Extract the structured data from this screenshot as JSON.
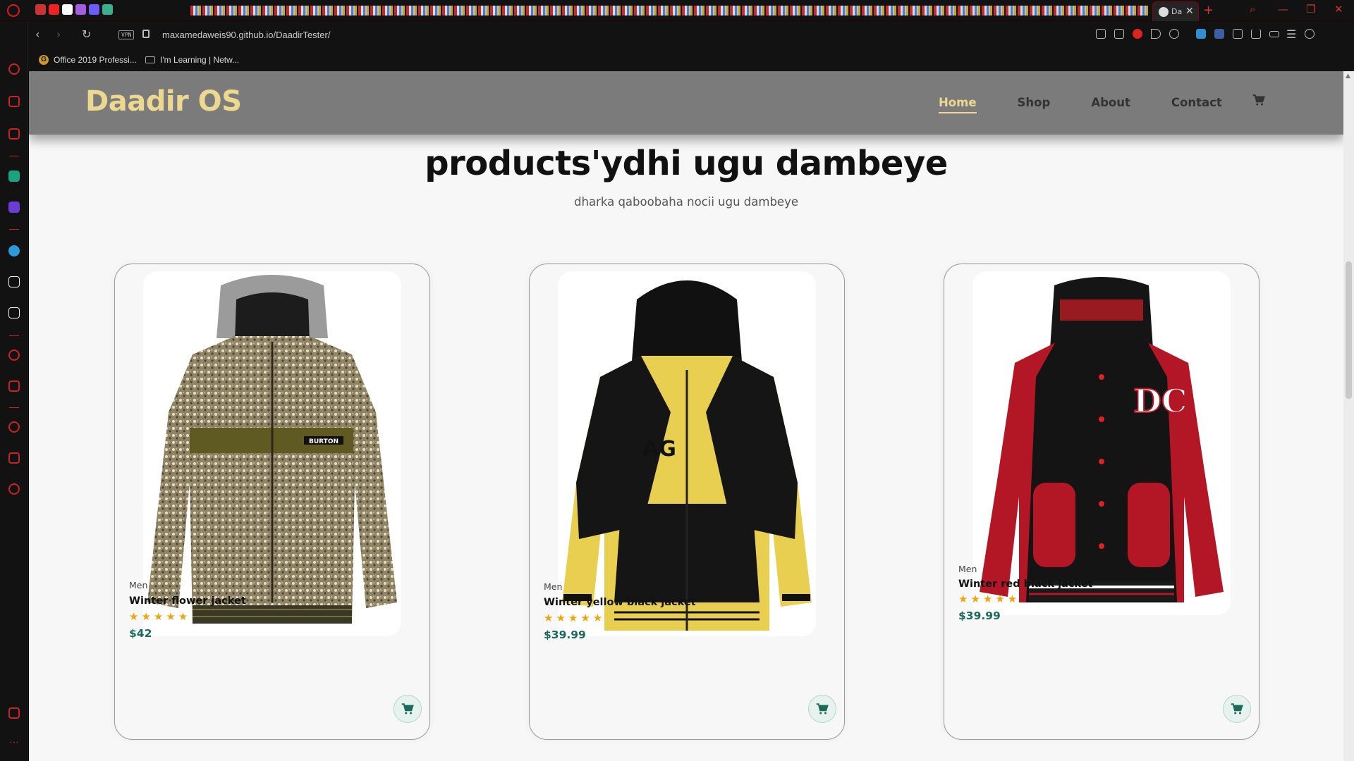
{
  "browser": {
    "active_tab_title": "Da",
    "url_host": "maxamedaweis90.github.io",
    "url_path": "/DaadirTester/",
    "vpn_label": "VPN",
    "bookmarks": [
      {
        "label": "Office 2019 Professi...",
        "icon": "g-icon"
      },
      {
        "label": "I'm Learning | Netw...",
        "icon": "bookmark-page-icon"
      }
    ]
  },
  "site": {
    "logo": "Daadir OS",
    "nav": [
      {
        "label": "Home",
        "active": true
      },
      {
        "label": "Shop",
        "active": false
      },
      {
        "label": "About",
        "active": false
      },
      {
        "label": "Contact",
        "active": false
      }
    ],
    "accent_color": "#ecd98f",
    "header_color": "#7b7b7b"
  },
  "section": {
    "title": "products'ydhi ugu dambeye",
    "subtitle": "dharka qaboobaha nocii ugu dambeye"
  },
  "products": [
    {
      "category": "Men",
      "name": "Winter flower jacket",
      "rating": 5,
      "stars": "★★★★★",
      "price": "$42",
      "image": "floral camouflage hooded jacket"
    },
    {
      "category": "Men",
      "name": "Winter yellow black jacket",
      "rating": 5,
      "stars": "★★★★★",
      "price": "$39.99",
      "image": "yellow and black hooded jacket"
    },
    {
      "category": "Men",
      "name": "Winter red black jacket",
      "rating": 5,
      "stars": "★★★★★",
      "price": "$39.99",
      "image": "red and black hooded jacket"
    }
  ]
}
